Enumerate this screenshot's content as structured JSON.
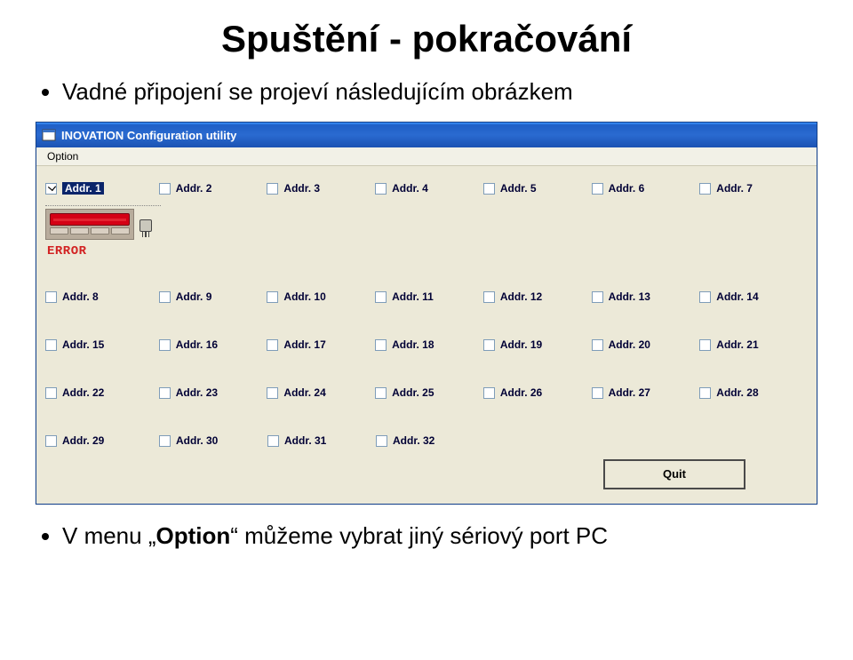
{
  "slide": {
    "title": "Spuštění - pokračování",
    "bullet1": "Vadné připojení se projeví následujícím obrázkem",
    "bullet2_pre": "V menu „",
    "bullet2_opt": "Option",
    "bullet2_post": "“ můžeme vybrat jiný sériový port PC"
  },
  "app": {
    "title": "INOVATION Configuration utility",
    "menu": {
      "option": "Option"
    },
    "error": "ERROR",
    "quit": "Quit",
    "addresses": {
      "row1": [
        {
          "label": "Addr. 1",
          "checked": true,
          "selected": true
        },
        {
          "label": "Addr. 2",
          "checked": false
        },
        {
          "label": "Addr. 3",
          "checked": false
        },
        {
          "label": "Addr. 4",
          "checked": false
        },
        {
          "label": "Addr. 5",
          "checked": false
        },
        {
          "label": "Addr. 6",
          "checked": false
        },
        {
          "label": "Addr. 7",
          "checked": false
        }
      ],
      "row2": [
        {
          "label": "Addr. 8"
        },
        {
          "label": "Addr. 9"
        },
        {
          "label": "Addr. 10"
        },
        {
          "label": "Addr. 11"
        },
        {
          "label": "Addr. 12"
        },
        {
          "label": "Addr. 13"
        },
        {
          "label": "Addr. 14"
        }
      ],
      "row3": [
        {
          "label": "Addr. 15"
        },
        {
          "label": "Addr. 16"
        },
        {
          "label": "Addr. 17"
        },
        {
          "label": "Addr. 18"
        },
        {
          "label": "Addr. 19"
        },
        {
          "label": "Addr. 20"
        },
        {
          "label": "Addr. 21"
        }
      ],
      "row4": [
        {
          "label": "Addr. 22"
        },
        {
          "label": "Addr. 23"
        },
        {
          "label": "Addr. 24"
        },
        {
          "label": "Addr. 25"
        },
        {
          "label": "Addr. 26"
        },
        {
          "label": "Addr. 27"
        },
        {
          "label": "Addr. 28"
        }
      ],
      "row5": [
        {
          "label": "Addr. 29"
        },
        {
          "label": "Addr. 30"
        },
        {
          "label": "Addr. 31"
        },
        {
          "label": "Addr. 32"
        }
      ]
    }
  }
}
